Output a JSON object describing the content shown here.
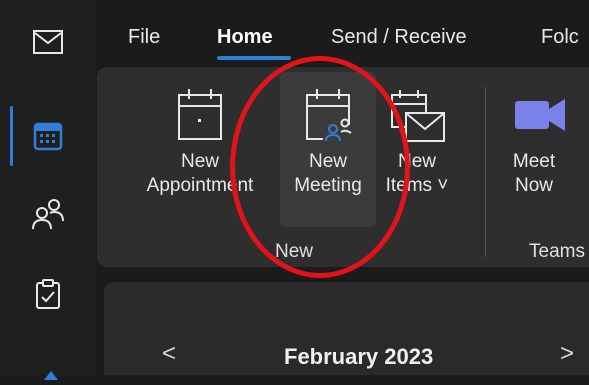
{
  "tabs": [
    "File",
    "Home",
    "Send / Receive",
    "Folc"
  ],
  "ribbon": {
    "buttons": [
      {
        "line1": "New",
        "line2": "Appointment"
      },
      {
        "line1": "New",
        "line2": "Meeting"
      },
      {
        "line1": "New",
        "line2": "Items ˅"
      },
      {
        "line1": "Meet",
        "line2": "Now"
      }
    ],
    "groups": [
      "New",
      "Teams"
    ]
  },
  "calendar": {
    "month": "February 2023",
    "prev": "<",
    "next": ">"
  },
  "colors": {
    "accent": "#2f7fd6",
    "annotation": "#e3121b",
    "teams": "#7b83eb"
  }
}
